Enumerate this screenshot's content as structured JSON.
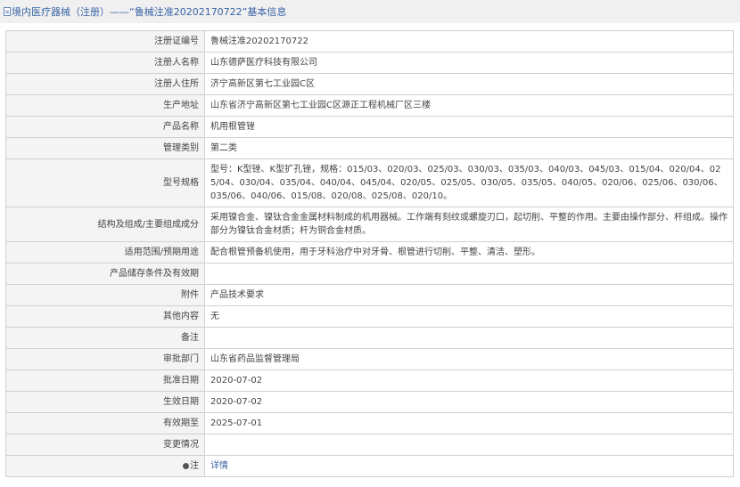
{
  "header": {
    "title": "境内医疗器械（注册）——“鲁械注准20202170722”基本信息"
  },
  "rows": [
    {
      "label": "注册证编号",
      "value": "鲁械注准20202170722"
    },
    {
      "label": "注册人名称",
      "value": "山东德萨医疗科技有限公司"
    },
    {
      "label": "注册人住所",
      "value": "济宁高新区第七工业园C区"
    },
    {
      "label": "生产地址",
      "value": "山东省济宁高新区第七工业园C区源正工程机械厂区三楼"
    },
    {
      "label": "产品名称",
      "value": "机用根管锉"
    },
    {
      "label": "管理类别",
      "value": "第二类"
    },
    {
      "label": "型号规格",
      "value": "型号：K型锉、K型扩孔锉，规格：015/03、020/03、025/03、030/03、035/03、040/03、045/03、015/04、020/04、025/04、030/04、035/04、040/04、045/04、020/05、025/05、030/05、035/05、040/05、020/06、025/06、030/06、035/06、040/06、015/08、020/08、025/08、020/10。"
    },
    {
      "label": "结构及组成/主要组成成分",
      "value": "采用镍合金、镍钛合金金属材料制成的机用器械。工作端有刻纹或螺旋刃口，起切削、平整的作用。主要由操作部分、杆组成。操作部分为镍钛合金材质；杆为铜合金材质。"
    },
    {
      "label": "适用范围/预期用途",
      "value": "配合根管预备机使用，用于牙科治疗中对牙骨、根管进行切削、平整、清洁、塑形。"
    },
    {
      "label": "产品储存条件及有效期",
      "value": ""
    },
    {
      "label": "附件",
      "value": "产品技术要求"
    },
    {
      "label": "其他内容",
      "value": "无"
    },
    {
      "label": "备注",
      "value": ""
    },
    {
      "label": "审批部门",
      "value": "山东省药品监督管理局"
    },
    {
      "label": "批准日期",
      "value": "2020-07-02"
    },
    {
      "label": "生效日期",
      "value": "2020-07-02"
    },
    {
      "label": "有效期至",
      "value": "2025-07-01"
    },
    {
      "label": "变更情况",
      "value": ""
    }
  ],
  "note_row": {
    "label": "注",
    "icon": "pin-icon",
    "link_text": "详情"
  },
  "colors": {
    "link": "#3a64a6",
    "label_bg": "#f4f4f4",
    "border": "#d0d0d0"
  }
}
